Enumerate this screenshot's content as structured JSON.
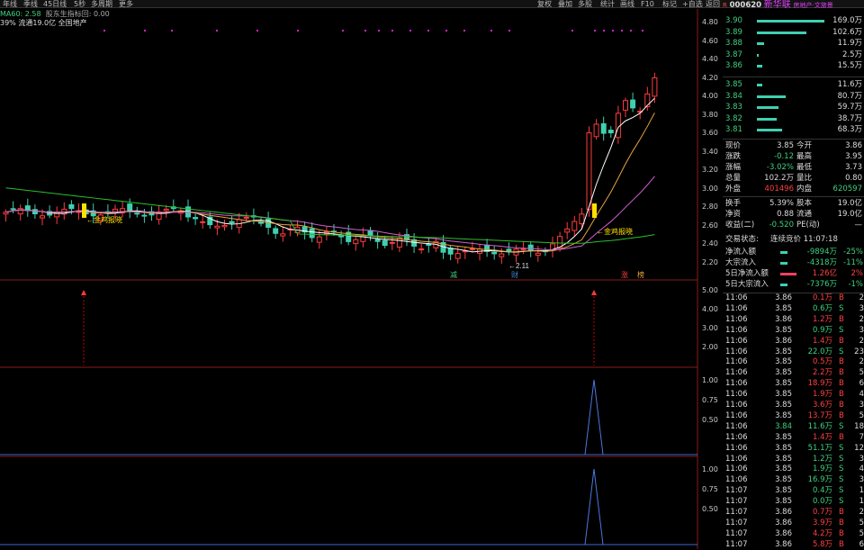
{
  "top_menu": [
    "年线",
    "季线",
    "45日线",
    "5秒",
    "多周期",
    "更多"
  ],
  "top_right_menu": [
    "复权",
    "叠加",
    "多股",
    "统计",
    "画线",
    "F10",
    "标记",
    "+自选",
    "返回"
  ],
  "info_line1": {
    "a": "MA60: 2.58",
    "b": "股东生指标回: 0.00"
  },
  "info_line2": "39% 流通19.0亿 全国地产",
  "stock": {
    "code": "000620",
    "name": "新华联",
    "tag": "房地产·文旅景",
    "r": "R"
  },
  "order_book": {
    "asks": [
      [
        "3.90",
        "169.0万"
      ],
      [
        "3.89",
        "102.6万"
      ],
      [
        "3.88",
        "11.9万"
      ],
      [
        "3.87",
        "2.5万"
      ],
      [
        "3.86",
        "15.5万"
      ]
    ],
    "bids": [
      [
        "3.85",
        "11.6万"
      ],
      [
        "3.84",
        "80.7万"
      ],
      [
        "3.83",
        "59.7万"
      ],
      [
        "3.82",
        "38.7万"
      ],
      [
        "3.81",
        "68.3万"
      ]
    ]
  },
  "quote": [
    [
      "现价",
      "3.85",
      "今开",
      "3.86"
    ],
    [
      "涨跌",
      "-0.12",
      "最高",
      "3.95"
    ],
    [
      "涨幅",
      "-3.02%",
      "最低",
      "3.73"
    ],
    [
      "总量",
      "102.2万",
      "量比",
      "0.80"
    ],
    [
      "外盘",
      "401496",
      "内盘",
      "620597"
    ]
  ],
  "quote2": [
    [
      "换手",
      "5.39%",
      "股本",
      "19.0亿"
    ],
    [
      "净资",
      "0.88",
      "流通",
      "19.0亿"
    ],
    [
      "收益(二)",
      "-0.520",
      "PE(动)",
      "—"
    ]
  ],
  "trade_status": {
    "label": "交易状态:",
    "value": "连续竞价 11:07:18"
  },
  "flows": [
    [
      "净流入额",
      "-9894万",
      "-25%"
    ],
    [
      "大宗流入",
      "-4318万",
      "-11%"
    ],
    [
      "5日净流入额",
      "1.26亿",
      "2%"
    ],
    [
      "5日大宗流入",
      "-7376万",
      "-1%"
    ]
  ],
  "ticks": [
    [
      "11:06",
      "3.86",
      "0.1万",
      "B",
      "2"
    ],
    [
      "11:06",
      "3.85",
      "0.6万",
      "S",
      "3"
    ],
    [
      "11:06",
      "3.86",
      "1.2万",
      "B",
      "2"
    ],
    [
      "11:06",
      "3.85",
      "0.9万",
      "S",
      "3"
    ],
    [
      "11:06",
      "3.86",
      "1.4万",
      "B",
      "2"
    ],
    [
      "11:06",
      "3.85",
      "22.0万",
      "S",
      "23"
    ],
    [
      "11:06",
      "3.85",
      "0.5万",
      "B",
      "2"
    ],
    [
      "11:06",
      "3.85",
      "2.2万",
      "B",
      "5"
    ],
    [
      "11:06",
      "3.85",
      "18.9万",
      "B",
      "6"
    ],
    [
      "11:06",
      "3.85",
      "1.9万",
      "B",
      "4"
    ],
    [
      "11:06",
      "3.85",
      "3.6万",
      "B",
      "3"
    ],
    [
      "11:06",
      "3.85",
      "13.7万",
      "B",
      "5"
    ],
    [
      "11:06",
      "3.84",
      "11.6万",
      "S",
      "18"
    ],
    [
      "11:06",
      "3.85",
      "1.4万",
      "B",
      "7"
    ],
    [
      "11:06",
      "3.85",
      "51.1万",
      "S",
      "12"
    ],
    [
      "11:06",
      "3.85",
      "1.2万",
      "S",
      "3"
    ],
    [
      "11:06",
      "3.85",
      "1.9万",
      "S",
      "4"
    ],
    [
      "11:06",
      "3.85",
      "16.9万",
      "S",
      "3"
    ],
    [
      "11:07",
      "3.85",
      "0.4万",
      "S",
      "1"
    ],
    [
      "11:07",
      "3.85",
      "0.0万",
      "S",
      "1"
    ],
    [
      "11:07",
      "3.86",
      "0.7万",
      "B",
      "2"
    ],
    [
      "11:07",
      "3.86",
      "3.9万",
      "B",
      "5"
    ],
    [
      "11:07",
      "3.86",
      "4.2万",
      "B",
      "5"
    ],
    [
      "11:07",
      "3.86",
      "5.8万",
      "B",
      "6"
    ]
  ],
  "chart_data": {
    "type": "candlestick",
    "main": {
      "ylim": [
        2.1,
        4.8
      ],
      "yticks": [
        "4.80",
        "4.60",
        "4.40",
        "4.20",
        "4.00",
        "3.80",
        "3.60",
        "3.40",
        "3.20",
        "3.00",
        "2.80",
        "2.60",
        "2.40",
        "2.20"
      ]
    },
    "panel2": {
      "ylim": [
        0,
        5.5
      ],
      "yticks": [
        "5.00",
        "4.00",
        "3.00",
        "2.00"
      ]
    },
    "panel3": {
      "ylim": [
        0,
        1.1
      ],
      "yticks": [
        "1.00",
        "0.75",
        "0.50"
      ]
    },
    "panel4": {
      "ylim": [
        0,
        1.1
      ],
      "yticks": [
        "1.00",
        "0.75",
        "0.50"
      ]
    },
    "annotations": [
      "金鸡报晓",
      "金鸡报晓",
      "2.11",
      "减",
      "财",
      "涨",
      "榜"
    ],
    "signals": [
      93,
      660
    ]
  }
}
